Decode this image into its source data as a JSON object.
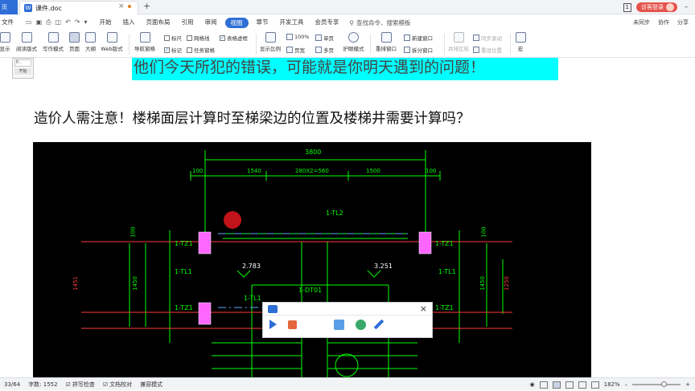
{
  "titlebar": {
    "app_tab": "页",
    "doc_tab": "课件.doc",
    "page_indicator": "1",
    "login": "访客登录"
  },
  "menubar": {
    "file": "文件",
    "items": [
      "开始",
      "插入",
      "页面布局",
      "引用",
      "审阅",
      "视图",
      "章节",
      "开发工具",
      "会员专享"
    ],
    "active": "视图",
    "search": "查找命令、搜索模板",
    "right": [
      "未同步",
      "协作",
      "分享"
    ]
  },
  "ribbon": {
    "buttons": [
      "显示",
      "阅读版式",
      "写作模式",
      "页面",
      "大纲",
      "Web版式",
      "导航窗格",
      "显示比例",
      "护眼模式",
      "重排窗口",
      "并排比较",
      "宏"
    ],
    "checkboxes": [
      {
        "label": "标尺",
        "checked": false
      },
      {
        "label": "网格线",
        "checked": false
      },
      {
        "label": "表格虚框",
        "checked": true
      },
      {
        "label": "标记",
        "checked": true
      },
      {
        "label": "任务窗格",
        "checked": false
      }
    ],
    "zoom": "100%",
    "single_page": "单页",
    "page_width": "页宽",
    "multi_page": "多页",
    "new_window": "新建窗口",
    "split_window": "拆分窗口",
    "sync_scroll": "同步滚动",
    "reset_position": "重设位置"
  },
  "sidepanel": {
    "item": "P...",
    "button": "开始"
  },
  "document": {
    "banner": "他们今天所犯的错误，可能就是你明天遇到的问题！",
    "heading": "造价人需注意！楼梯面层计算时至梯梁边的位置及楼梯井需要计算吗？"
  },
  "cad": {
    "dims_top": [
      "3800",
      "100",
      "1540",
      "280X2=560",
      "1500",
      "100"
    ],
    "labels": [
      "1-TL2",
      "1-TZ1",
      "1-TZ1",
      "1-TZ1",
      "1-TZ1",
      "1-TL1",
      "1-TL1",
      "1-DT01",
      "1-TL1",
      "2.783",
      "3.251"
    ],
    "dims_side": [
      "1451",
      "1450",
      "100",
      "100",
      "1450",
      "1250"
    ]
  },
  "statusbar": {
    "page": "33/64",
    "wordcount": "字数: 1552",
    "spellcheck": "拼写检查",
    "proofread": "文档校对",
    "compat": "兼容模式",
    "zoom": "182%"
  },
  "colors": {
    "accent": "#2f6ed6",
    "banner_bg": "#00ffff",
    "cad_bg": "#000000",
    "cad_green": "#00ff00",
    "cad_magenta": "#ff66ff"
  }
}
